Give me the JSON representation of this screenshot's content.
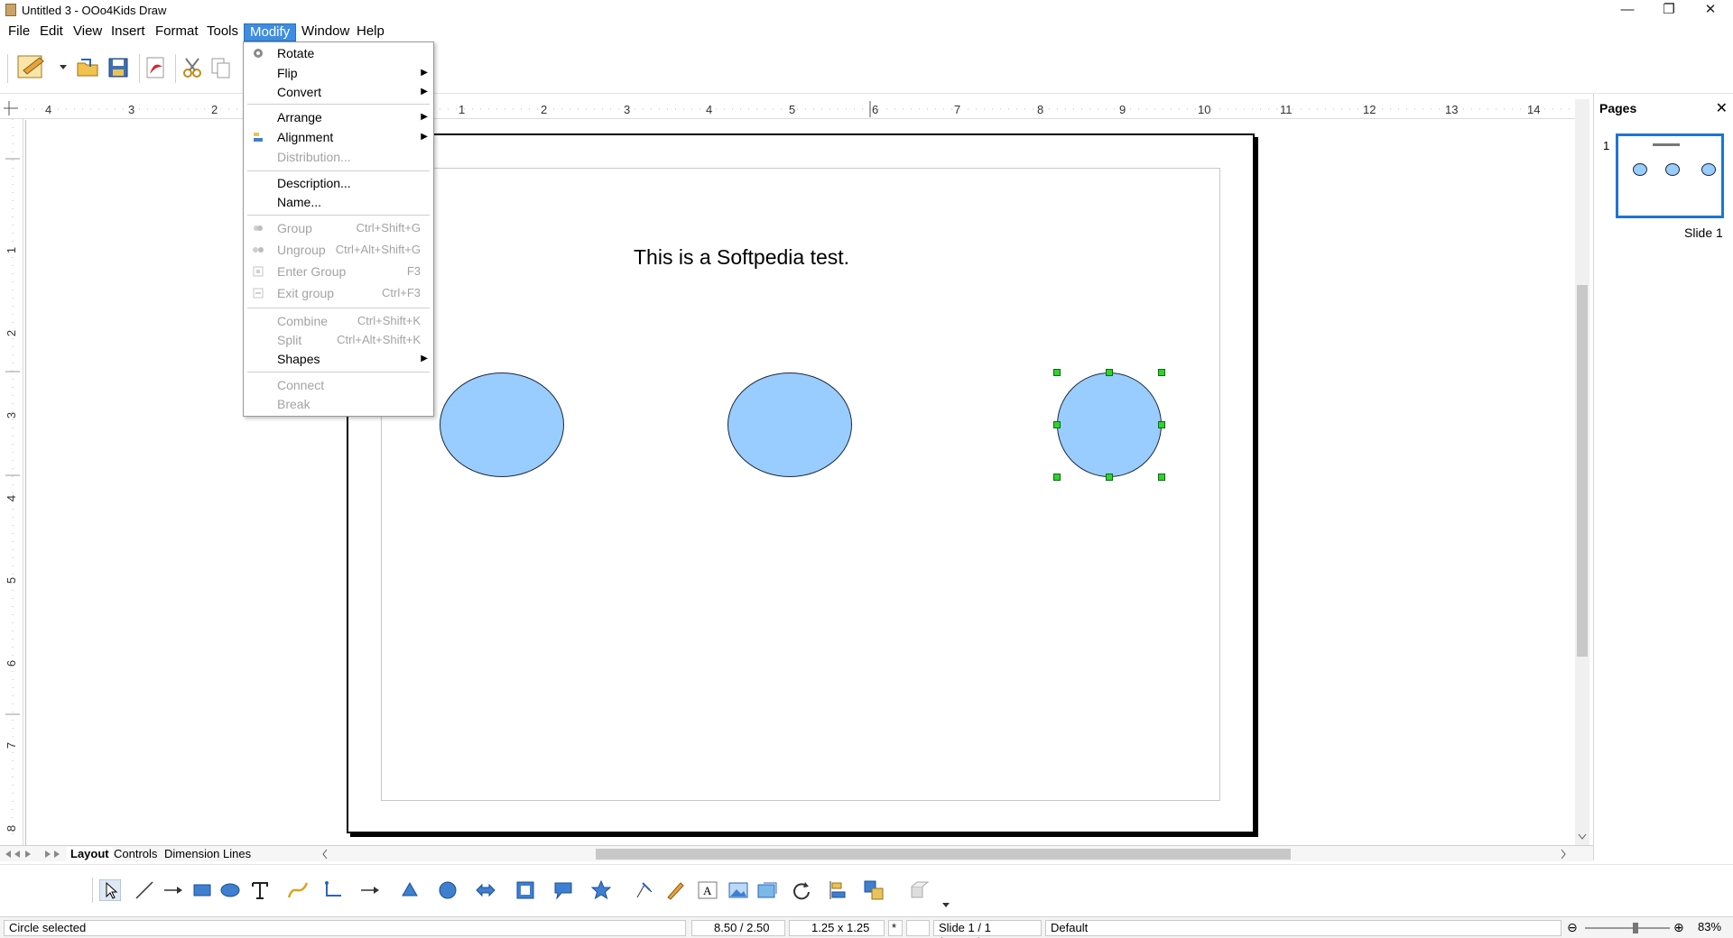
{
  "window": {
    "title": "Untitled 3 - OOo4Kids Draw",
    "minimize_glyph": "—",
    "restore_glyph": "❐",
    "close_glyph": "✕"
  },
  "menubar": {
    "items": [
      "File",
      "Edit",
      "View",
      "Insert",
      "Format",
      "Tools",
      "Modify",
      "Window",
      "Help"
    ],
    "active": "Modify"
  },
  "modify_menu": {
    "items": [
      {
        "label": "Rotate",
        "shortcut": "",
        "submenu": false,
        "disabled": false,
        "icon": "rotate-icon"
      },
      {
        "label": "Flip",
        "shortcut": "",
        "submenu": true,
        "disabled": false,
        "icon": ""
      },
      {
        "label": "Convert",
        "shortcut": "",
        "submenu": true,
        "disabled": false,
        "icon": ""
      },
      {
        "label": "Arrange",
        "shortcut": "",
        "submenu": true,
        "disabled": false,
        "icon": ""
      },
      {
        "label": "Alignment",
        "shortcut": "",
        "submenu": true,
        "disabled": false,
        "icon": "alignment-icon"
      },
      {
        "label": "Distribution...",
        "shortcut": "",
        "submenu": false,
        "disabled": true,
        "icon": ""
      },
      {
        "label": "Description...",
        "shortcut": "",
        "submenu": false,
        "disabled": false,
        "icon": ""
      },
      {
        "label": "Name...",
        "shortcut": "",
        "submenu": false,
        "disabled": false,
        "icon": ""
      },
      {
        "label": "Group",
        "shortcut": "Ctrl+Shift+G",
        "submenu": false,
        "disabled": true,
        "icon": "group-icon"
      },
      {
        "label": "Ungroup",
        "shortcut": "Ctrl+Alt+Shift+G",
        "submenu": false,
        "disabled": true,
        "icon": "ungroup-icon"
      },
      {
        "label": "Enter Group",
        "shortcut": "F3",
        "submenu": false,
        "disabled": true,
        "icon": "enter-group-icon"
      },
      {
        "label": "Exit group",
        "shortcut": "Ctrl+F3",
        "submenu": false,
        "disabled": true,
        "icon": "exit-group-icon"
      },
      {
        "label": "Combine",
        "shortcut": "Ctrl+Shift+K",
        "submenu": false,
        "disabled": true,
        "icon": ""
      },
      {
        "label": "Split",
        "shortcut": "Ctrl+Alt+Shift+K",
        "submenu": false,
        "disabled": true,
        "icon": ""
      },
      {
        "label": "Shapes",
        "shortcut": "",
        "submenu": true,
        "disabled": false,
        "icon": ""
      },
      {
        "label": "Connect",
        "shortcut": "",
        "submenu": false,
        "disabled": true,
        "icon": ""
      },
      {
        "label": "Break",
        "shortcut": "",
        "submenu": false,
        "disabled": true,
        "icon": ""
      }
    ]
  },
  "ruler": {
    "h_labels": [
      "4",
      "3",
      "2",
      "1",
      "2",
      "3",
      "4",
      "5",
      "6",
      "7",
      "8",
      "9",
      "10",
      "11",
      "12",
      "13",
      "14"
    ],
    "v_labels": [
      "1",
      "2",
      "3",
      "4",
      "5",
      "6",
      "7",
      "8"
    ]
  },
  "slide": {
    "text": "This is a Softpedia test.",
    "shape_fill": "#99ccff",
    "selection_handle_color": "#2fd22f"
  },
  "pages_panel": {
    "title": "Pages",
    "close_glyph": "✕",
    "slide_number": "1",
    "slide_label": "Slide 1"
  },
  "tabs": [
    "Layout",
    "Controls",
    "Dimension Lines"
  ],
  "active_tab": "Layout",
  "statusbar": {
    "status": "Circle selected",
    "position": "8.50 / 2.50",
    "size": "1.25 x 1.25",
    "modified_marker": "*",
    "slide_info": "Slide 1 / 1 (Layout)",
    "master": "Default",
    "zoom": "83%",
    "zoom_level": 0.6
  },
  "colors": {
    "accent": "#3d8ee2",
    "selection_border": "#1e73d6",
    "disabled_text": "#a3a3a3"
  }
}
